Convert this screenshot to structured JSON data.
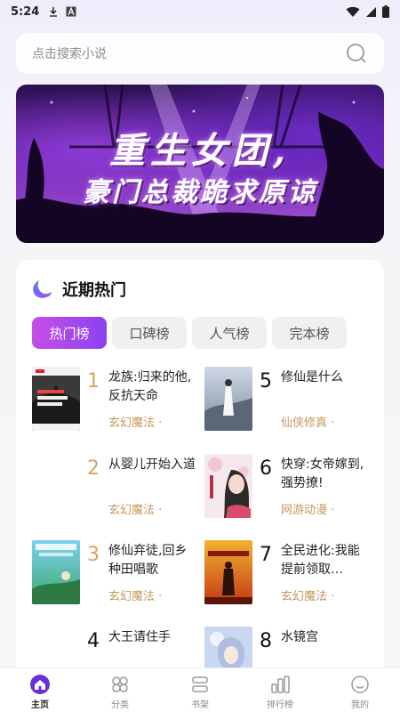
{
  "status_bar": {
    "time": "5:24",
    "icons": [
      "download-icon",
      "font-icon",
      "wifi-icon",
      "signal-icon",
      "battery-icon"
    ]
  },
  "search": {
    "placeholder": "点击搜索小说",
    "icon": "search-icon"
  },
  "banner": {
    "title_line1": "重生女团,",
    "title_line2": "豪门总裁跪求原谅"
  },
  "section": {
    "title": "近期热门",
    "tabs": [
      "热门榜",
      "口碑榜",
      "人气榜",
      "完本榜"
    ],
    "active_tab": 0
  },
  "books": [
    {
      "rank": "1",
      "title": "龙族:归来的他,反抗天命",
      "genre": "玄幻魔法 ·"
    },
    {
      "rank": "2",
      "title": "从婴儿开始入道",
      "genre": "玄幻魔法 ·"
    },
    {
      "rank": "3",
      "title": "修仙弃徒,回乡种田唱歌",
      "genre": "玄幻魔法 ·"
    },
    {
      "rank": "4",
      "title": "大王请住手",
      "genre": ""
    },
    {
      "rank": "5",
      "title": "修仙是什么",
      "genre": "仙侠修真 ·"
    },
    {
      "rank": "6",
      "title": "快穿:女帝嫁到,强势撩!",
      "genre": "网游动漫 ·"
    },
    {
      "rank": "7",
      "title": "全民进化:我能提前领取…",
      "genre": "玄幻魔法 ·"
    },
    {
      "rank": "8",
      "title": "水镜宫",
      "genre": ""
    }
  ],
  "bottom_nav": [
    {
      "label": "主页",
      "icon": "home-icon"
    },
    {
      "label": "分类",
      "icon": "category-icon"
    },
    {
      "label": "书架",
      "icon": "bookshelf-icon"
    },
    {
      "label": "排行榜",
      "icon": "ranking-icon"
    },
    {
      "label": "我的",
      "icon": "profile-icon"
    }
  ],
  "colors": {
    "accent_start": "#c54ee8",
    "accent_end": "#8a43f0",
    "rank_gold": "#d9a55a",
    "genre": "#c5975a"
  }
}
